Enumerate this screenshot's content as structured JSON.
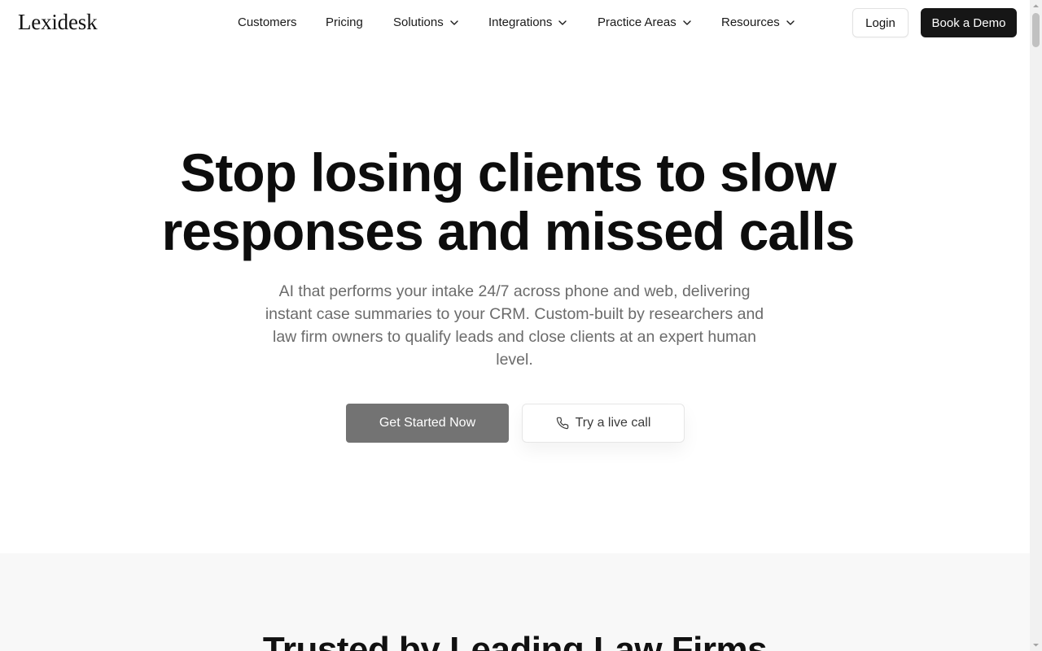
{
  "brand": {
    "logo_text": "Lexidesk"
  },
  "nav": {
    "items": [
      {
        "label": "Customers",
        "has_dropdown": false
      },
      {
        "label": "Pricing",
        "has_dropdown": false
      },
      {
        "label": "Solutions",
        "has_dropdown": true
      },
      {
        "label": "Integrations",
        "has_dropdown": true
      },
      {
        "label": "Practice Areas",
        "has_dropdown": true
      },
      {
        "label": "Resources",
        "has_dropdown": true
      }
    ],
    "login_label": "Login",
    "demo_label": "Book a Demo"
  },
  "hero": {
    "title_line1": "Stop losing clients to slow",
    "title_line2": "responses and missed calls",
    "subtitle": "AI that performs your intake 24/7 across phone and web, delivering instant case summaries to your CRM. Custom-built by researchers and law firm owners to qualify leads and close clients at an expert human level.",
    "primary_cta": "Get Started Now",
    "secondary_cta": "Try a live call",
    "secondary_cta_icon": "phone-icon"
  },
  "trusted": {
    "title": "Trusted by Leading Law Firms"
  },
  "colors": {
    "primary_button": "#737373",
    "demo_button": "#161616",
    "subtitle_text": "#6b6b6b",
    "section_bg": "#f8f8f8"
  }
}
